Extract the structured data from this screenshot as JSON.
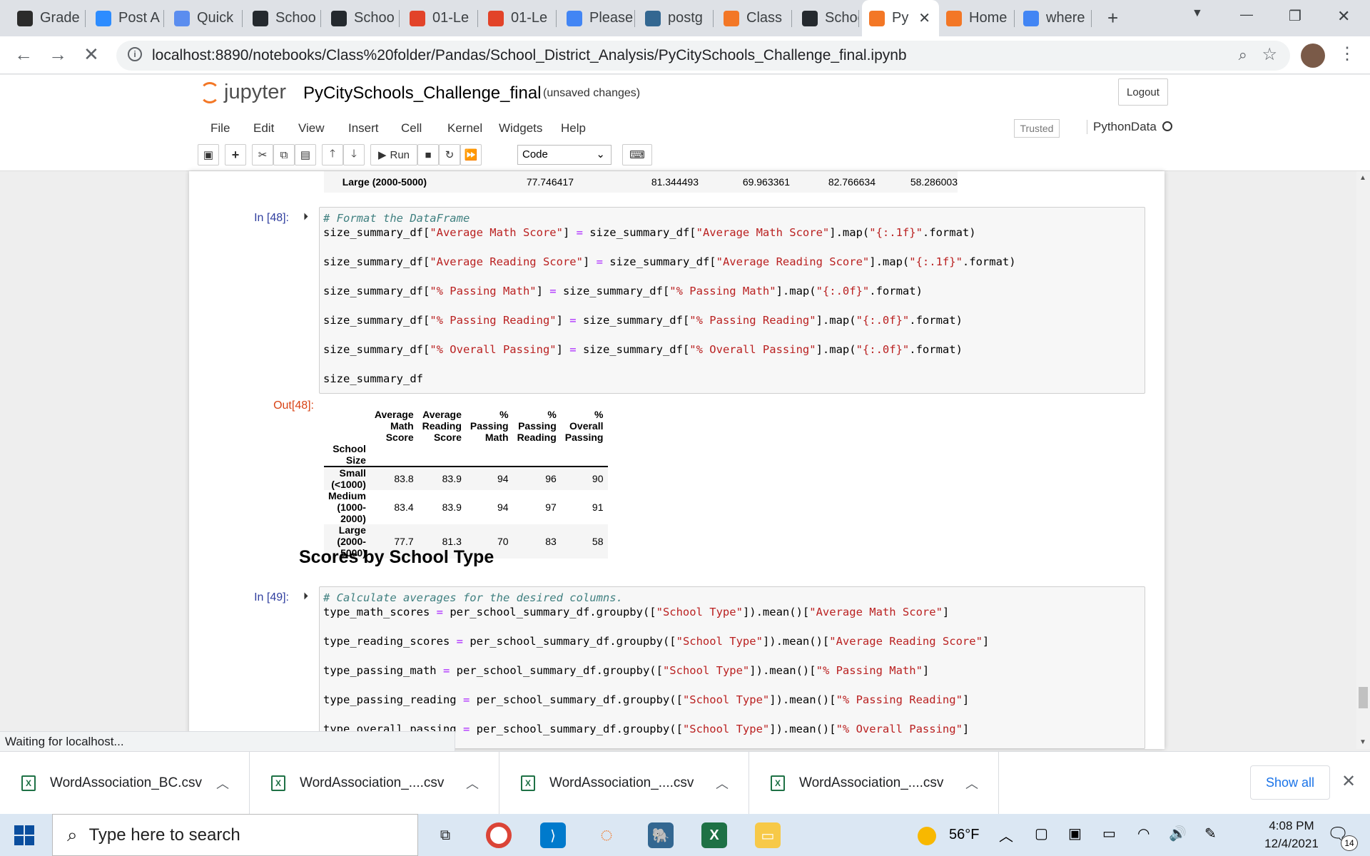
{
  "browser": {
    "tabs": [
      {
        "label": "Grade",
        "icon": "grade-icon",
        "color": "#2b2b2b"
      },
      {
        "label": "Post A",
        "icon": "zoom-icon",
        "color": "#2d8cff"
      },
      {
        "label": "Quick",
        "icon": "bolt-icon",
        "color": "#5b8def"
      },
      {
        "label": "Schoo",
        "icon": "github-icon",
        "color": "#24292e"
      },
      {
        "label": "Schoo",
        "icon": "github-icon",
        "color": "#24292e"
      },
      {
        "label": "01-Le",
        "icon": "gitlab-icon",
        "color": "#e24329"
      },
      {
        "label": "01-Le",
        "icon": "gitlab-icon",
        "color": "#e24329"
      },
      {
        "label": "Please",
        "icon": "google-icon",
        "color": "#4285f4"
      },
      {
        "label": "postg",
        "icon": "postgres-icon",
        "color": "#336791"
      },
      {
        "label": "Class",
        "icon": "jupyter-icon",
        "color": "#f37726"
      },
      {
        "label": "Schoo",
        "icon": "github-icon",
        "color": "#24292e"
      },
      {
        "label": "Py",
        "icon": "jupyter-icon",
        "color": "#f37726"
      },
      {
        "label": "Home",
        "icon": "jupyter-icon",
        "color": "#f37726"
      },
      {
        "label": "where",
        "icon": "google-icon",
        "color": "#4285f4"
      }
    ],
    "url": "localhost:8890/notebooks/Class%20folder/Pandas/School_District_Analysis/PyCitySchools_Challenge_final.ipynb",
    "status": "Waiting for localhost..."
  },
  "jupyter": {
    "logo": "jupyter",
    "title": "PyCitySchools_Challenge_final",
    "unsaved": "(unsaved changes)",
    "logout": "Logout",
    "menus": [
      "File",
      "Edit",
      "View",
      "Insert",
      "Cell",
      "Kernel",
      "Widgets",
      "Help"
    ],
    "trusted": "Trusted",
    "kernel": "PythonData",
    "run_label": "Run",
    "cell_type": "Code"
  },
  "prev_row": {
    "label": "Large (2000-5000)",
    "values": [
      "77.746417",
      "81.344493",
      "69.963361",
      "82.766634",
      "58.286003"
    ]
  },
  "cell48": {
    "in_prompt": "In [48]:",
    "out_prompt": "Out[48]:",
    "comment": "# Format the DataFrame",
    "lines": [
      "size_summary_df[\"Average Math Score\"] = size_summary_df[\"Average Math Score\"].map(\"{:.1f}\".format)",
      "size_summary_df[\"Average Reading Score\"] = size_summary_df[\"Average Reading Score\"].map(\"{:.1f}\".format)",
      "size_summary_df[\"% Passing Math\"] = size_summary_df[\"% Passing Math\"].map(\"{:.0f}\".format)",
      "size_summary_df[\"% Passing Reading\"] = size_summary_df[\"% Passing Reading\"].map(\"{:.0f}\".format)",
      "size_summary_df[\"% Overall Passing\"] = size_summary_df[\"% Overall Passing\"].map(\"{:.0f}\".format)",
      "size_summary_df"
    ],
    "table": {
      "columns": [
        "Average Math Score",
        "Average Reading Score",
        "% Passing Math",
        "% Passing Reading",
        "% Overall Passing"
      ],
      "index_name": "School Size",
      "rows": [
        {
          "label": "Small (<1000)",
          "values": [
            "83.8",
            "83.9",
            "94",
            "96",
            "90"
          ]
        },
        {
          "label": "Medium (1000-2000)",
          "values": [
            "83.4",
            "83.9",
            "94",
            "97",
            "91"
          ]
        },
        {
          "label": "Large (2000-5000)",
          "values": [
            "77.7",
            "81.3",
            "70",
            "83",
            "58"
          ]
        }
      ]
    }
  },
  "heading": "Scores by School Type",
  "cell49": {
    "in_prompt": "In [49]:",
    "comment": "# Calculate averages for the desired columns.",
    "lines": [
      "type_math_scores = per_school_summary_df.groupby([\"School Type\"]).mean()[\"Average Math Score\"]",
      "type_reading_scores = per_school_summary_df.groupby([\"School Type\"]).mean()[\"Average Reading Score\"]",
      "type_passing_math = per_school_summary_df.groupby([\"School Type\"]).mean()[\"% Passing Math\"]",
      "type_passing_reading = per_school_summary_df.groupby([\"School Type\"]).mean()[\"% Passing Reading\"]",
      "type_overall_passing = per_school_summary_df.groupby([\"School Type\"]).mean()[\"% Overall Passing\"]"
    ]
  },
  "downloads": {
    "items": [
      "WordAssociation_BC.csv",
      "WordAssociation_....csv",
      "WordAssociation_....csv",
      "WordAssociation_....csv"
    ],
    "show_all": "Show all"
  },
  "taskbar": {
    "search_placeholder": "Type here to search",
    "weather": "56°F",
    "time": "4:08 PM",
    "date": "12/4/2021",
    "notifications": "14"
  }
}
